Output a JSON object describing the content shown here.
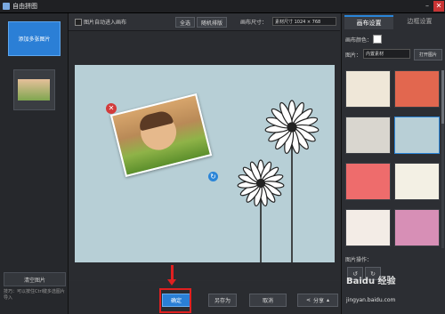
{
  "window": {
    "title": "自由拼图",
    "minimize": "–",
    "close": "✕"
  },
  "left": {
    "add_button": "添加多张图片",
    "clear_button": "清空图片",
    "tip": "技巧：可以按住Ctrl键多选图片导入"
  },
  "toolbar": {
    "auto_checkbox_label": "图片自动进入画布",
    "select_all": "全选",
    "random_layout": "随机排版",
    "size_label": "画布尺寸：",
    "size_value": "素材尺寸 1024 × 768"
  },
  "canvas": {
    "bg_color": "#b7cfd6"
  },
  "bottom": {
    "ok": "确定",
    "save_as": "另存为",
    "cancel": "取消",
    "share": "分享"
  },
  "right": {
    "tabs": [
      "画布设置",
      "边框设置"
    ],
    "bg_color_label": "画布颜色：",
    "image_label": "图片：",
    "image_select": "内置素材",
    "open_button": "打开图片",
    "ops_label": "图片操作：",
    "templates": [
      {
        "color": "#efe7d8"
      },
      {
        "color": "#e2674f"
      },
      {
        "color": "#d9d6cf"
      },
      {
        "color": "#b8cfd6"
      },
      {
        "color": "#ee6c6c"
      },
      {
        "color": "#f3f0e4"
      },
      {
        "color": "#f3ece6"
      },
      {
        "color": "#d78fb6"
      }
    ]
  },
  "watermark": {
    "brand": "Baidu 经验",
    "url": "jingyan.baidu.com"
  },
  "accent": "#2a85d8",
  "highlight": "#e02020"
}
